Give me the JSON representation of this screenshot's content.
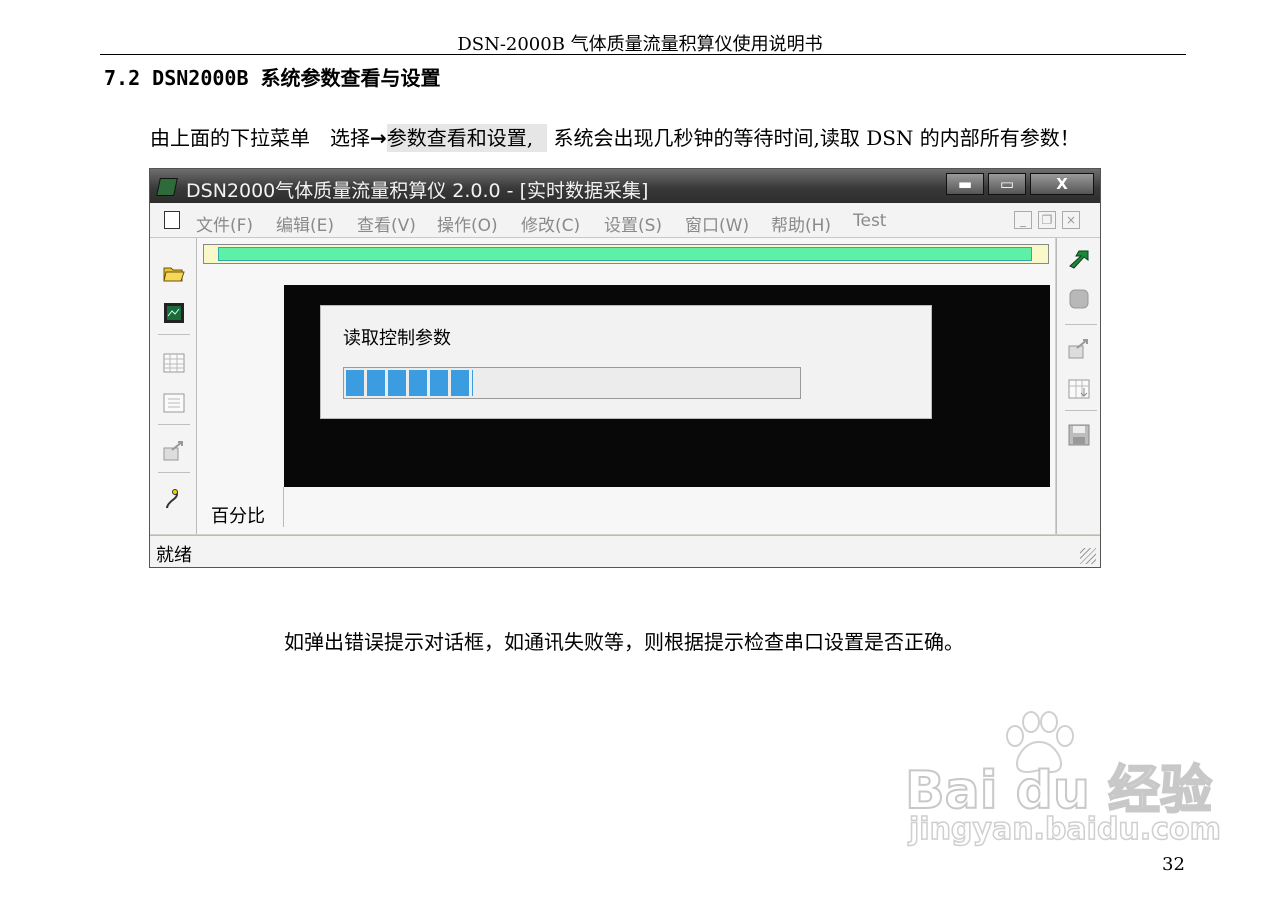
{
  "doc": {
    "header": "DSN-2000B 气体质量流量积算仪使用说明书",
    "section_title": "7.2 DSN2000B 系统参数查看与设置",
    "intro_before": "由上面的下拉菜单　选择",
    "intro_arrow": "→",
    "intro_highlight": "参数查看和设置,",
    "intro_after": "系统会出现几秒钟的等待时间,读取 DSN 的内部所有参数！",
    "note": "如弹出错误提示对话框，如通讯失败等，则根据提示检查串口设置是否正确。",
    "page_number": "32"
  },
  "window": {
    "title": "DSN2000气体质量流量积算仪 2.0.0 - [实时数据采集]",
    "buttons": {
      "minimize": "▬",
      "maximize": "▭",
      "close": "X"
    },
    "menu": [
      "文件(F)",
      "编辑(E)",
      "查看(V)",
      "操作(O)",
      "修改(C)",
      "设置(S)",
      "窗口(W)",
      "帮助(H)",
      "Test"
    ],
    "mdi_buttons": [
      "_",
      "❐",
      "×"
    ],
    "dialog": {
      "title": "读取控制参数",
      "progress": 0.28
    },
    "percent_label": "百分比",
    "status": "就绪"
  },
  "watermark": {
    "brand": "Bai du 经验",
    "url": "jingyan.baidu.com"
  },
  "colors": {
    "progress": "#3b9de0",
    "top_bar": "#5ff0a8",
    "title_bar": "#3a3a3a"
  }
}
